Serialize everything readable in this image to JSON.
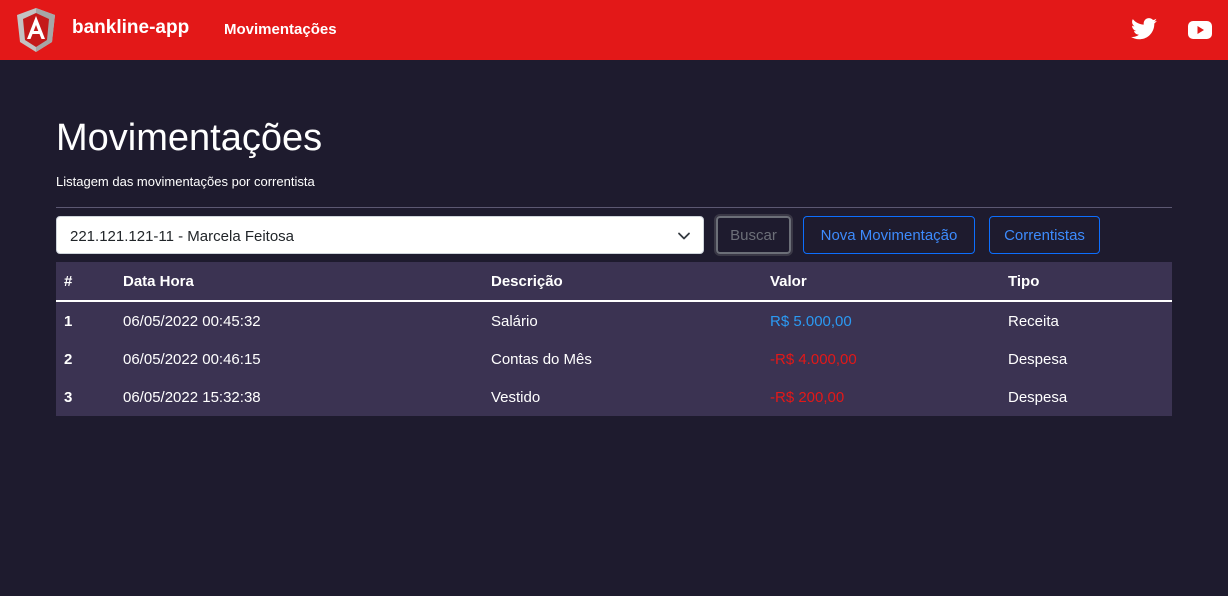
{
  "navbar": {
    "brand": "bankline-app",
    "nav_link": "Movimentações",
    "icons": [
      "angular-logo",
      "twitter-icon",
      "youtube-icon"
    ],
    "color": "#e31818"
  },
  "header": {
    "title": "Movimentações",
    "subtitle": "Listagem das movimentações por correntista"
  },
  "filter": {
    "selected": "221.121.121-11 - Marcela Feitosa"
  },
  "buttons": {
    "buscar": "Buscar",
    "nova": "Nova Movimentação",
    "correntistas": "Correntistas"
  },
  "table": {
    "headers": [
      "#",
      "Data Hora",
      "Descrição",
      "Valor",
      "Tipo"
    ],
    "rows": [
      {
        "id": "1",
        "data_hora": "06/05/2022 00:45:32",
        "descricao": "Salário",
        "valor": "R$ 5.000,00",
        "tipo": "Receita"
      },
      {
        "id": "2",
        "data_hora": "06/05/2022 00:46:15",
        "descricao": "Contas do Mês",
        "valor": "-R$ 4.000,00",
        "tipo": "Despesa"
      },
      {
        "id": "3",
        "data_hora": "06/05/2022 15:32:38",
        "descricao": "Vestido",
        "valor": "-R$ 200,00",
        "tipo": "Despesa"
      }
    ]
  },
  "colors": {
    "receita": "#2b9af3",
    "despesa": "#e31818",
    "background": "#1e1b2e",
    "table_bg": "#3b3352"
  }
}
